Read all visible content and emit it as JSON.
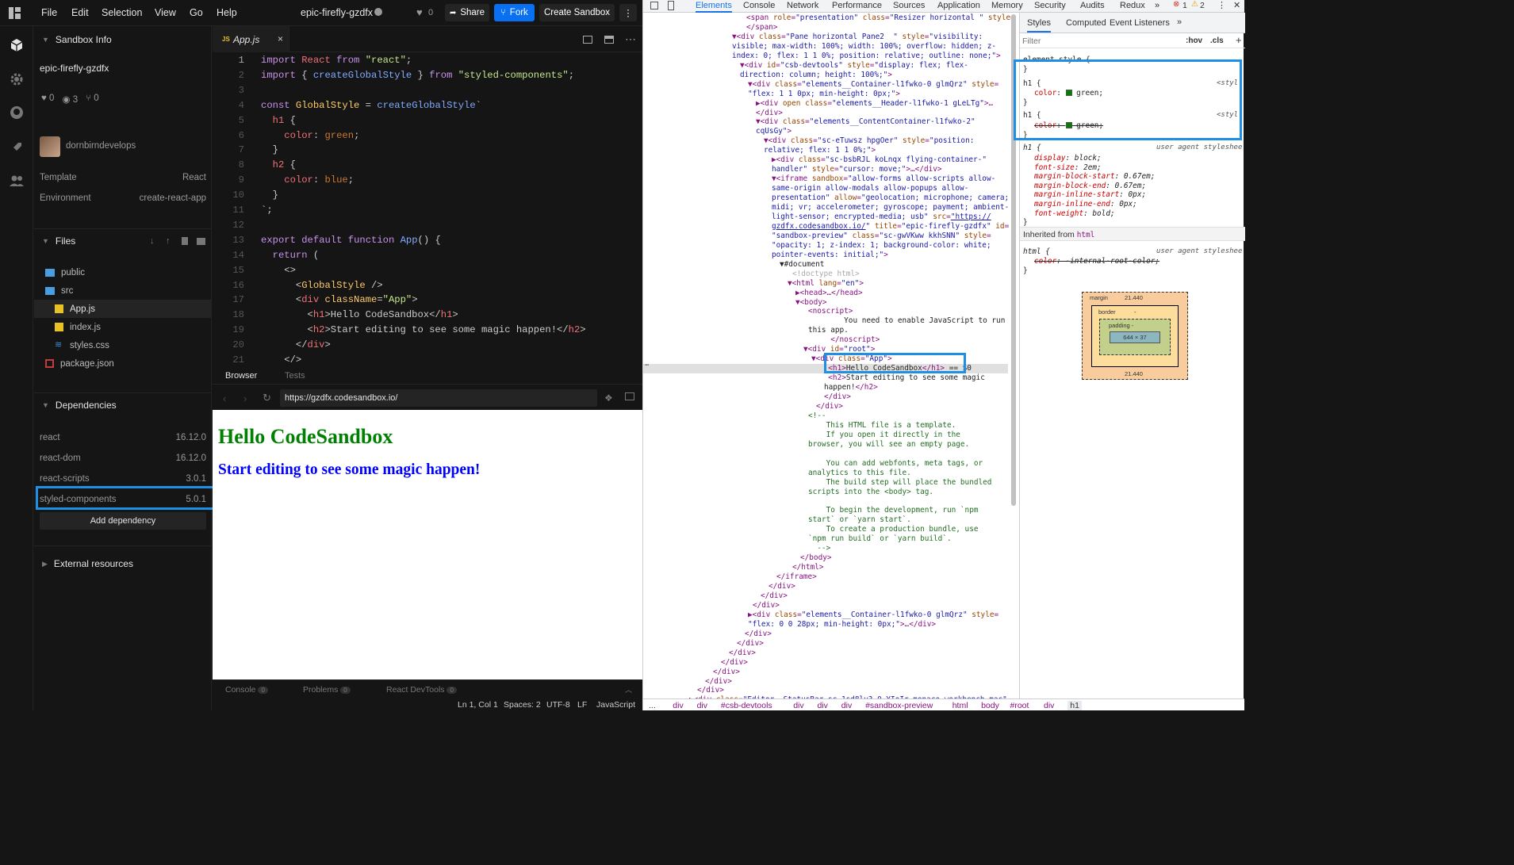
{
  "topbar": {
    "menu": [
      "File",
      "Edit",
      "Selection",
      "View",
      "Go",
      "Help"
    ],
    "sandbox_name": "epic-firefly-gzdfx",
    "likes": "0",
    "share_label": "Share",
    "fork_label": "Fork",
    "create_label": "Create Sandbox"
  },
  "sidebar": {
    "sandbox_info_title": "Sandbox Info",
    "sandbox_name": "epic-firefly-gzdfx",
    "stats": {
      "likes": "0",
      "views": "3",
      "forks": "0"
    },
    "author": "dornbirndevelops",
    "template_label": "Template",
    "template_value": "React",
    "environment_label": "Environment",
    "environment_value": "create-react-app",
    "files_title": "Files",
    "files": [
      {
        "name": "public",
        "kind": "folder"
      },
      {
        "name": "src",
        "kind": "folder-open"
      },
      {
        "name": "App.js",
        "kind": "js"
      },
      {
        "name": "index.js",
        "kind": "js"
      },
      {
        "name": "styles.css",
        "kind": "css"
      },
      {
        "name": "package.json",
        "kind": "json"
      }
    ],
    "dependencies_title": "Dependencies",
    "dependencies": [
      {
        "name": "react",
        "version": "16.12.0"
      },
      {
        "name": "react-dom",
        "version": "16.12.0"
      },
      {
        "name": "react-scripts",
        "version": "3.0.1"
      },
      {
        "name": "styled-components",
        "version": "5.0.1"
      }
    ],
    "add_dependency_label": "Add dependency",
    "external_resources_title": "External resources"
  },
  "editor": {
    "tab_name": "App.js",
    "tab_icon": "JS"
  },
  "browser": {
    "tab_browser": "Browser",
    "tab_tests": "Tests",
    "url": "https://gzdfx.codesandbox.io/",
    "preview_h1": "Hello CodeSandbox",
    "preview_h2": "Start editing to see some magic happen!",
    "h1_color": "#008000",
    "h2_color": "#0000ff"
  },
  "bottombar": {
    "console_label": "Console",
    "console_count": "0",
    "problems_label": "Problems",
    "problems_count": "0",
    "devtools_label": "React DevTools",
    "devtools_count": "0"
  },
  "statusbar": {
    "position": "Ln 1, Col 1",
    "spaces": "Spaces: 2",
    "encoding": "UTF-8",
    "eol": "LF",
    "language": "JavaScript"
  },
  "devtools": {
    "tabs": [
      "Elements",
      "Console",
      "Network",
      "Performance",
      "Sources",
      "Application",
      "Memory",
      "Security",
      "Audits",
      "Redux"
    ],
    "errors": "1",
    "warnings": "2",
    "styles_tabs": [
      "Styles",
      "Computed",
      "Event Listeners"
    ],
    "filter_placeholder": "Filter",
    "hov_label": ":hov",
    "cls_label": ".cls",
    "element_style": "element.style {",
    "rule_source": "<styl",
    "ua_label": "user agent styleshee",
    "inherited_label": "Inherited from",
    "inherited_tag": "html",
    "box_margin_label": "margin",
    "box_margin_value": "21.440",
    "box_border_label": "border",
    "box_padding_label": "padding -",
    "box_content": "644 × 37",
    "box_dash": "-",
    "crumbs": [
      "...",
      "div",
      "div",
      "#csb-devtools",
      "div",
      "div",
      "div",
      "#sandbox-preview",
      "html",
      "body",
      "#root",
      "div",
      "h1"
    ]
  }
}
